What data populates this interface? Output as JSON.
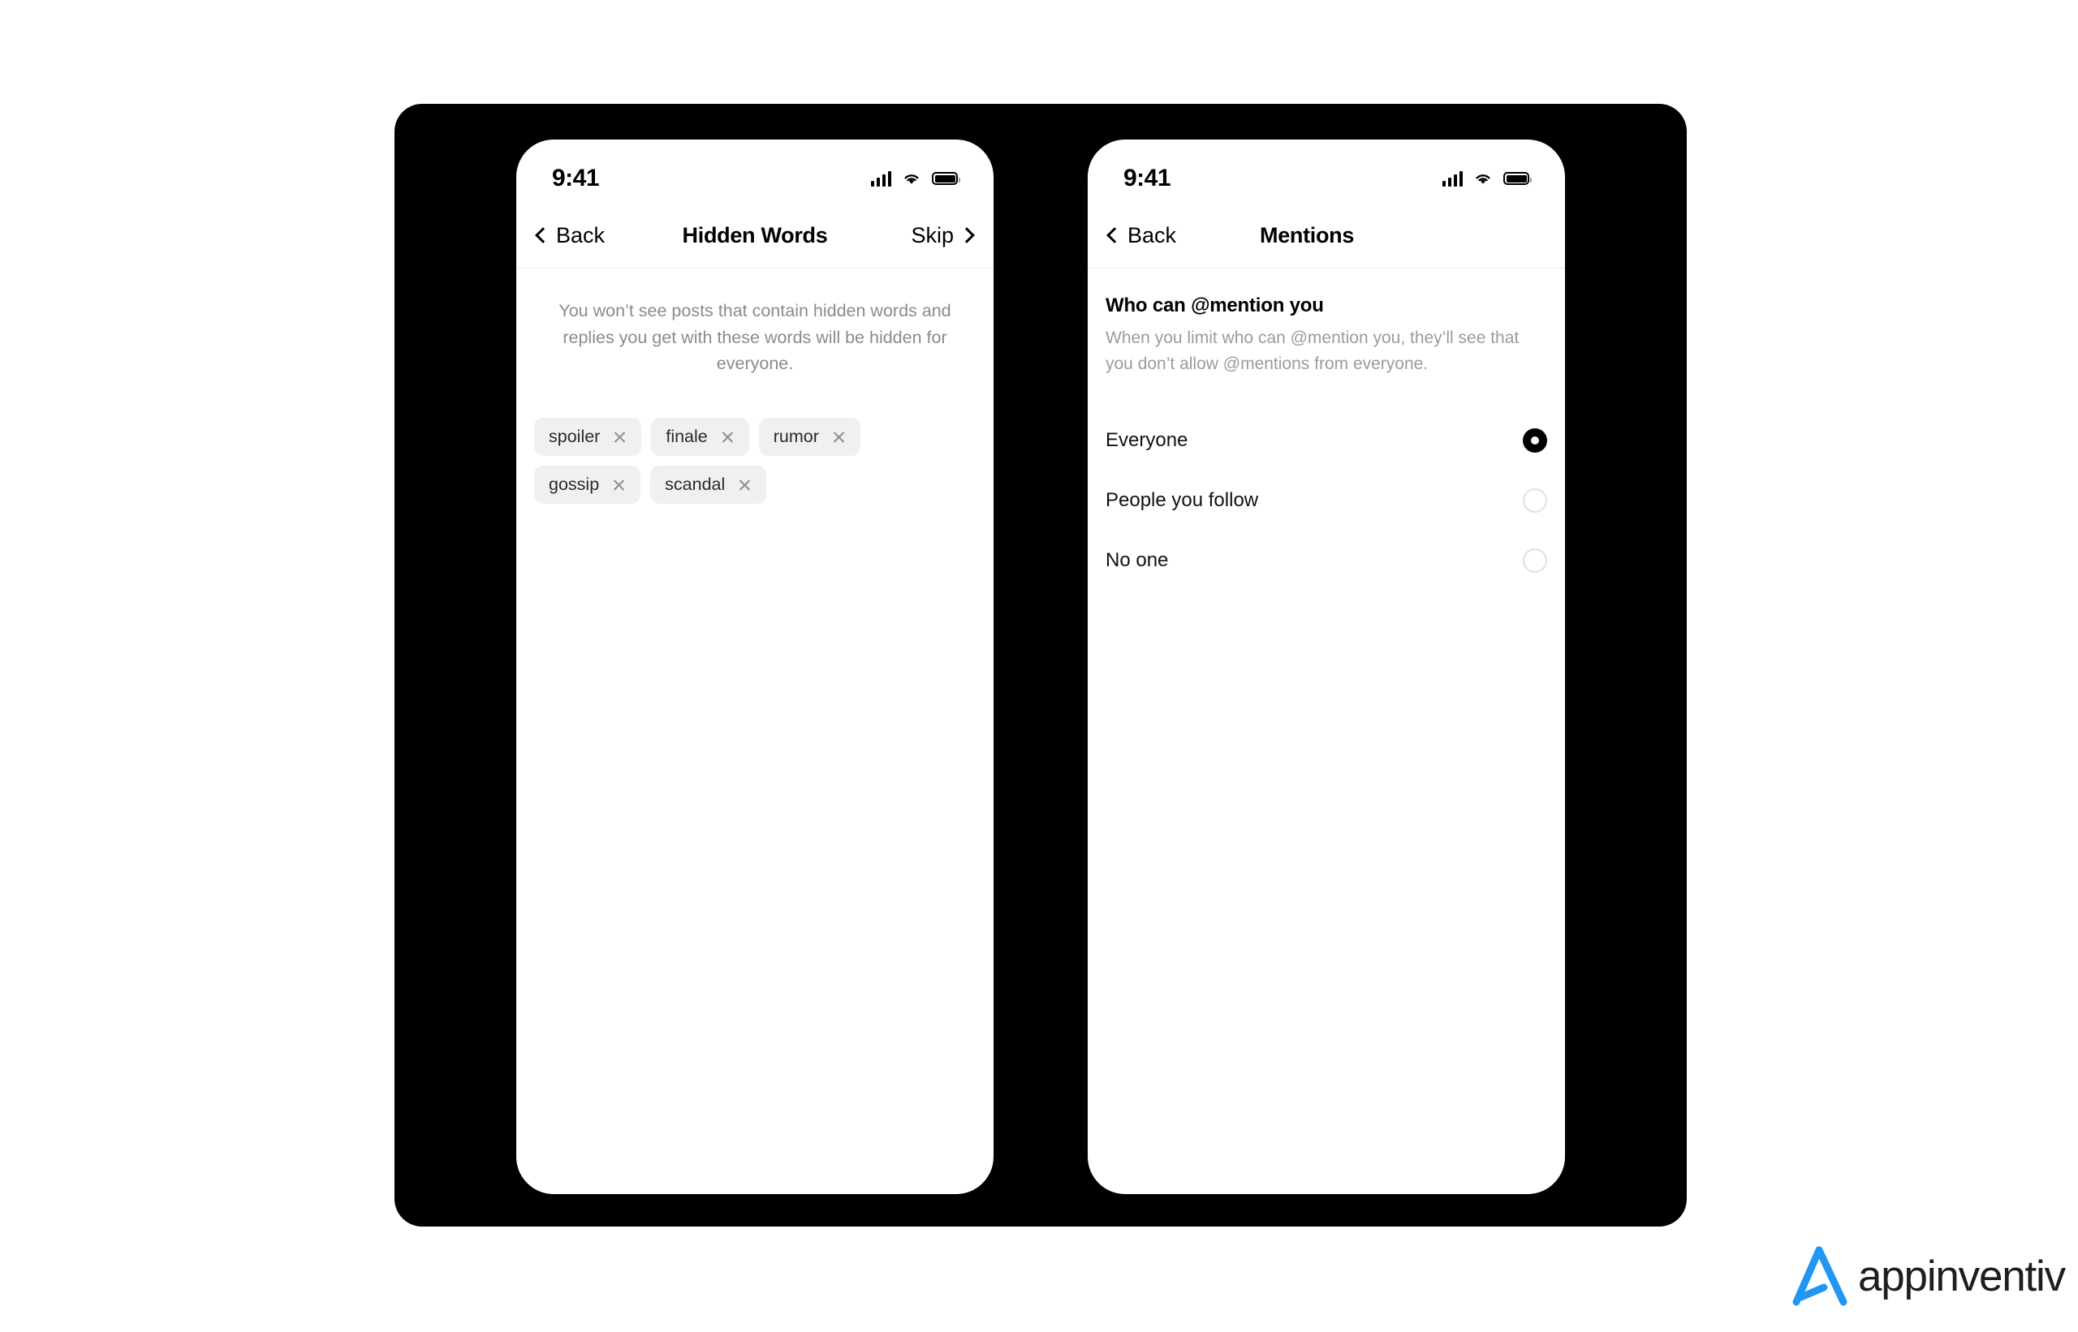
{
  "brand": {
    "name": "appinventiv",
    "mark_color": "#2196f3",
    "text_color": "#1e1e1e",
    "icon": "appinventiv-a-mark-icon"
  },
  "device_frame": {
    "background_color": "#000000",
    "screen_color": "#ffffff"
  },
  "phones": [
    {
      "id": "hidden-words",
      "status_bar": {
        "time": "9:41",
        "icons": [
          "cellular-signal-icon",
          "wifi-icon",
          "battery-icon"
        ]
      },
      "nav": {
        "back_label": "Back",
        "title": "Hidden Words",
        "action_label": "Skip",
        "back_icon": "chevron-left-icon",
        "action_icon": "chevron-right-icon"
      },
      "description": "You won’t see posts that contain hidden words and replies you get with these words will be hidden for everyone.",
      "chips": [
        {
          "label": "spoiler",
          "remove_icon": "close-icon"
        },
        {
          "label": "finale",
          "remove_icon": "close-icon"
        },
        {
          "label": "rumor",
          "remove_icon": "close-icon"
        },
        {
          "label": "gossip",
          "remove_icon": "close-icon"
        },
        {
          "label": "scandal",
          "remove_icon": "close-icon"
        }
      ],
      "chip_background": "#f0f0f0"
    },
    {
      "id": "mentions",
      "status_bar": {
        "time": "9:41",
        "icons": [
          "cellular-signal-icon",
          "wifi-icon",
          "battery-icon"
        ]
      },
      "nav": {
        "back_label": "Back",
        "title": "Mentions",
        "back_icon": "chevron-left-icon"
      },
      "section": {
        "title": "Who can @mention you",
        "subtitle": "When you limit who can @mention you, they’ll see that you don’t allow @mentions from everyone."
      },
      "options": [
        {
          "label": "Everyone",
          "selected": true
        },
        {
          "label": "People you follow",
          "selected": false
        },
        {
          "label": "No one",
          "selected": false
        }
      ],
      "selected_value": "Everyone"
    }
  ]
}
